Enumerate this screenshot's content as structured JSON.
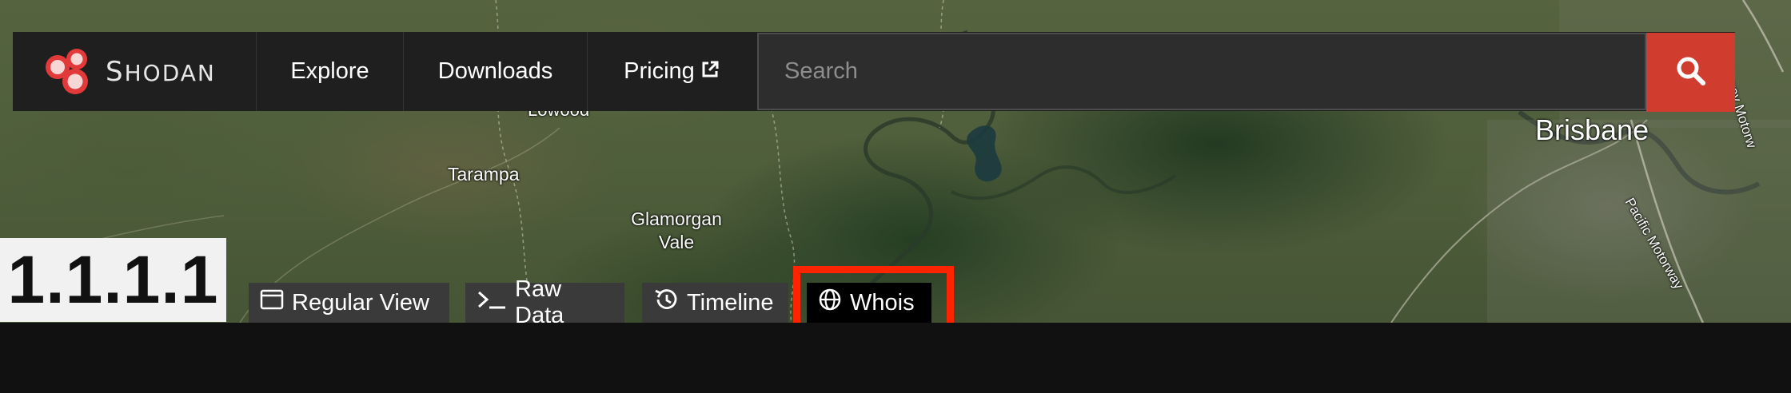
{
  "navbar": {
    "brand": "SHODAN",
    "brand_first": "S",
    "brand_rest": "HODAN",
    "items": [
      {
        "label": "Explore"
      },
      {
        "label": "Downloads"
      },
      {
        "label": "Pricing"
      }
    ],
    "search": {
      "placeholder": "Search",
      "value": ""
    },
    "search_button_icon": "search-icon"
  },
  "map": {
    "labels": {
      "lowood": "Lowood",
      "tarampa": "Tarampa",
      "glamorgan_vale": "Glamorgan\nVale",
      "brisbane": "Brisbane",
      "gateway_motorway": "Gateway Motorw",
      "pacific_motorway": "Pacific Motorway"
    }
  },
  "host": {
    "ip": "1.1.1.1",
    "tabs": [
      {
        "label": "Regular View",
        "icon": "window-icon"
      },
      {
        "label": "Raw Data",
        "icon": "terminal-icon"
      },
      {
        "label": "Timeline",
        "icon": "history-icon"
      },
      {
        "label": "Whois",
        "icon": "globe-icon",
        "active": true
      }
    ]
  },
  "colors": {
    "accent_red": "#d03d2f",
    "highlight": "#ff2400",
    "navbar_bg": "#1f1f1f"
  }
}
